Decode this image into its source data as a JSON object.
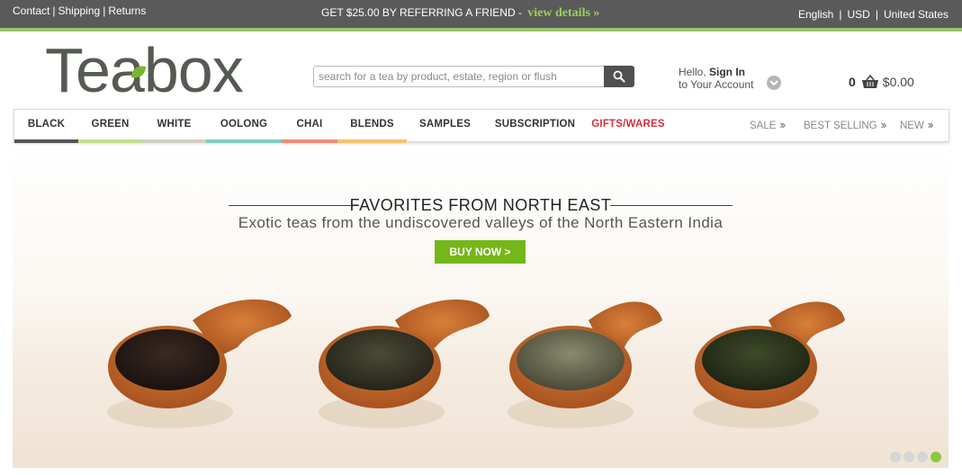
{
  "topbar": {
    "contact": "Contact",
    "shipping": "Shipping",
    "returns": "Returns",
    "separator": "|",
    "promo_text": "GET $25.00 BY REFERRING A FRIEND - ",
    "promo_link": "view details »",
    "language": "English",
    "currency": "USD",
    "country": "United States"
  },
  "header": {
    "logo_text": "Teabox",
    "search_placeholder": "search for a tea by product, estate, region or flush",
    "account_hello": "Hello, ",
    "account_signin": "Sign In",
    "account_sub": "to Your Account",
    "cart_count": "0",
    "cart_amount": "$0.00"
  },
  "nav": {
    "items": [
      {
        "label": "BLACK",
        "color": "#555555"
      },
      {
        "label": "GREEN",
        "color": "#c3de8e"
      },
      {
        "label": "WHITE",
        "color": "#d3cfc4"
      },
      {
        "label": "OOLONG",
        "color": "#7fcdc3"
      },
      {
        "label": "CHAI",
        "color": "#f08c78"
      },
      {
        "label": "BLENDS",
        "color": "#f7c46c"
      },
      {
        "label": "SAMPLES",
        "color": ""
      },
      {
        "label": "SUBSCRIPTION",
        "color": ""
      },
      {
        "label": "GIFTS/WARES",
        "color": ""
      }
    ],
    "right": [
      "SALE",
      "BEST SELLING",
      "NEW"
    ],
    "chevron": "››"
  },
  "hero": {
    "title": "FAVORITES FROM NORTH EAST",
    "subtitle": "Exotic teas from the undiscovered valleys of the North Eastern India",
    "button": "BUY NOW >",
    "slides_total": 4,
    "slide_active": 4
  },
  "colors": {
    "topbar_bg": "#5a5a5a",
    "accent_green": "#74b71a",
    "gifts_red": "#d0303a"
  }
}
